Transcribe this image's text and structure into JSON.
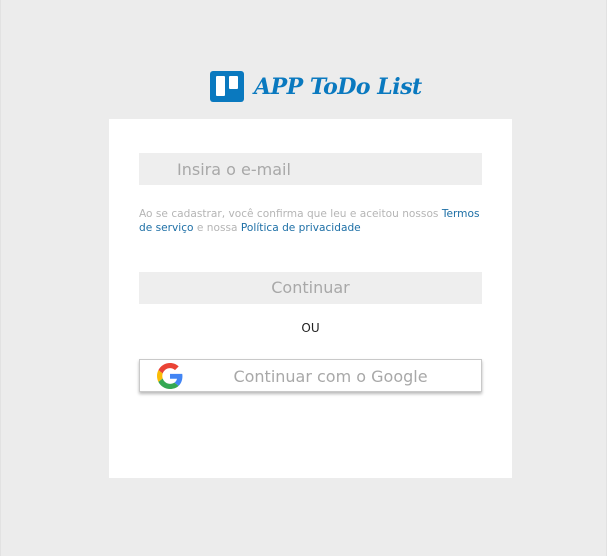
{
  "brand": {
    "title": "APP ToDo List",
    "color": "#0a79bf"
  },
  "login": {
    "email_placeholder": "Insira o e-mail",
    "terms_prefix": "Ao se cadastrar, você confirma que leu e aceitou nossos",
    "terms_link": "Termos de serviço",
    "terms_middle": "e nossa",
    "privacy_link": "Política de privacidade",
    "continue_label": "Continuar",
    "or_label": "OU",
    "google_label": "Continuar com o Google",
    "google_icon": "google-g-logo"
  },
  "colors": {
    "page_background": "#ececec",
    "card_background": "#ffffff",
    "link": "#1d6fa6",
    "input_background": "#eeeeee"
  }
}
